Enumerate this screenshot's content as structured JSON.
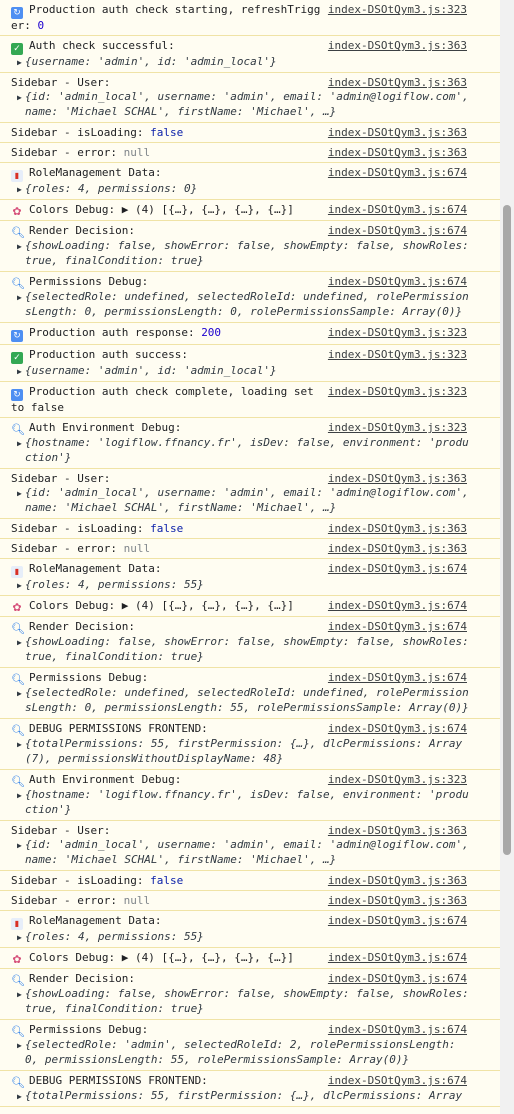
{
  "entries": [
    {
      "icon": "sync",
      "text": "Production auth check starting, refreshTrigger: ",
      "num": "0",
      "src": "index-DSOtQym3.js:323"
    },
    {
      "icon": "check",
      "text": "Auth check successful:",
      "src": "index-DSOtQym3.js:363",
      "sub": "{username: 'admin', id: 'admin_local'}"
    },
    {
      "icon": "",
      "text": "Sidebar - User:",
      "src": "index-DSOtQym3.js:363",
      "sub1": "{id: 'admin_local', username: 'admin', email: 'admin@logiflow.com',",
      "sub2": "name: 'Michael SCHAL', firstName: 'Michael', …}"
    },
    {
      "icon": "",
      "text": "Sidebar - isLoading: ",
      "bool": "false",
      "src": "index-DSOtQym3.js:363"
    },
    {
      "icon": "",
      "text": "Sidebar - error: ",
      "null": "null",
      "src": "index-DSOtQym3.js:363"
    },
    {
      "icon": "chart",
      "text": "RoleManagement Data:",
      "src": "index-DSOtQym3.js:674",
      "sub": "{roles: 4, permissions: 0}"
    },
    {
      "icon": "palette",
      "text": "Colors Debug: ",
      "inline": "▶ (4) [{…}, {…}, {…}, {…}]",
      "src": "index-DSOtQym3.js:674"
    },
    {
      "icon": "search",
      "text": "Render Decision:",
      "src": "index-DSOtQym3.js:674",
      "sub1": "{showLoading: false, showError: false, showEmpty: false, showRoles:",
      "sub2": "true, finalCondition: true}"
    },
    {
      "icon": "search",
      "text": "Permissions Debug:",
      "src": "index-DSOtQym3.js:674",
      "sub1": "{selectedRole: undefined, selectedRoleId: undefined, rolePermission",
      "sub2": "sLength: 0, permissionsLength: 0, rolePermissionsSample: Array(0)}"
    },
    {
      "icon": "sync",
      "text": "Production auth response: ",
      "num": "200",
      "src": "index-DSOtQym3.js:323"
    },
    {
      "icon": "check",
      "text": "Production auth success:",
      "src": "index-DSOtQym3.js:323",
      "sub": "{username: 'admin', id: 'admin_local'}"
    },
    {
      "icon": "sync",
      "text": "Production auth check complete, loading set to false",
      "src": "index-DSOtQym3.js:323"
    },
    {
      "icon": "search",
      "text": "Auth Environment Debug:",
      "src": "index-DSOtQym3.js:323",
      "sub1": "{hostname: 'logiflow.ffnancy.fr', isDev: false, environment: 'produ",
      "sub2": "ction'}"
    },
    {
      "icon": "",
      "text": "Sidebar - User:",
      "src": "index-DSOtQym3.js:363",
      "sub1": "{id: 'admin_local', username: 'admin', email: 'admin@logiflow.com',",
      "sub2": "name: 'Michael SCHAL', firstName: 'Michael', …}"
    },
    {
      "icon": "",
      "text": "Sidebar - isLoading: ",
      "bool": "false",
      "src": "index-DSOtQym3.js:363"
    },
    {
      "icon": "",
      "text": "Sidebar - error: ",
      "null": "null",
      "src": "index-DSOtQym3.js:363"
    },
    {
      "icon": "chart",
      "text": "RoleManagement Data:",
      "src": "index-DSOtQym3.js:674",
      "sub": "{roles: 4, permissions: 55}"
    },
    {
      "icon": "palette",
      "text": "Colors Debug: ",
      "inline": "▶ (4) [{…}, {…}, {…}, {…}]",
      "src": "index-DSOtQym3.js:674"
    },
    {
      "icon": "search",
      "text": "Render Decision:",
      "src": "index-DSOtQym3.js:674",
      "sub1": "{showLoading: false, showError: false, showEmpty: false, showRoles:",
      "sub2": "true, finalCondition: true}"
    },
    {
      "icon": "search",
      "text": "Permissions Debug:",
      "src": "index-DSOtQym3.js:674",
      "sub1": "{selectedRole: undefined, selectedRoleId: undefined, rolePermission",
      "sub2": "sLength: 0, permissionsLength: 55, rolePermissionsSample: Array(0)}"
    },
    {
      "icon": "search",
      "text": "DEBUG PERMISSIONS FRONTEND:",
      "src": "index-DSOtQym3.js:674",
      "sub1": "{totalPermissions: 55, firstPermission: {…}, dlcPermissions: Array",
      "sub2": "(7), permissionsWithoutDisplayName: 48}"
    },
    {
      "icon": "search",
      "text": "Auth Environment Debug:",
      "src": "index-DSOtQym3.js:323",
      "sub1": "{hostname: 'logiflow.ffnancy.fr', isDev: false, environment: 'produ",
      "sub2": "ction'}"
    },
    {
      "icon": "",
      "text": "Sidebar - User:",
      "src": "index-DSOtQym3.js:363",
      "sub1": "{id: 'admin_local', username: 'admin', email: 'admin@logiflow.com',",
      "sub2": "name: 'Michael SCHAL', firstName: 'Michael', …}"
    },
    {
      "icon": "",
      "text": "Sidebar - isLoading: ",
      "bool": "false",
      "src": "index-DSOtQym3.js:363"
    },
    {
      "icon": "",
      "text": "Sidebar - error: ",
      "null": "null",
      "src": "index-DSOtQym3.js:363"
    },
    {
      "icon": "chart",
      "text": "RoleManagement Data:",
      "src": "index-DSOtQym3.js:674",
      "sub": "{roles: 4, permissions: 55}"
    },
    {
      "icon": "palette",
      "text": "Colors Debug: ",
      "inline": "▶ (4) [{…}, {…}, {…}, {…}]",
      "src": "index-DSOtQym3.js:674"
    },
    {
      "icon": "search",
      "text": "Render Decision:",
      "src": "index-DSOtQym3.js:674",
      "sub1": "{showLoading: false, showError: false, showEmpty: false, showRoles:",
      "sub2": "true, finalCondition: true}"
    },
    {
      "icon": "search",
      "text": "Permissions Debug:",
      "src": "index-DSOtQym3.js:674",
      "sub1": "{selectedRole: 'admin', selectedRoleId: 2, rolePermissionsLength:",
      "sub2": "0, permissionsLength: 55, rolePermissionsSample: Array(0)}"
    },
    {
      "icon": "search",
      "text": "DEBUG PERMISSIONS FRONTEND:",
      "src": "index-DSOtQym3.js:674",
      "sub1": "{totalPermissions: 55, firstPermission: {…}, dlcPermissions: Array"
    }
  ]
}
